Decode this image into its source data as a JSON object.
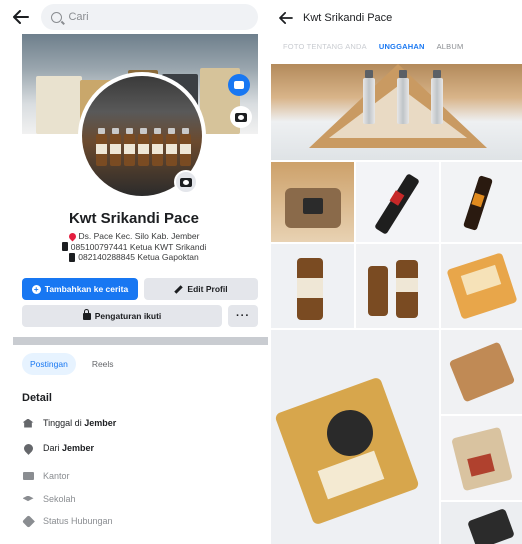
{
  "left": {
    "search": {
      "placeholder": "Cari"
    },
    "profile": {
      "name": "Kwt Srikandi Pace",
      "bio": [
        "Ds. Pace Kec. Silo Kab. Jember",
        "085100797441 Ketua KWT Srikandi",
        "082140288845 Ketua Gapoktan"
      ]
    },
    "buttons": {
      "add_story": "Tambahkan ke cerita",
      "edit_profile": "Edit Profil",
      "follow_settings": "Pengaturan ikuti",
      "more": "···"
    },
    "tabs": [
      "Postingan",
      "Reels"
    ],
    "details": {
      "title": "Detail",
      "lives_prefix": "Tinggal di",
      "lives_value": "Jember",
      "from_prefix": "Dari",
      "from_value": "Jember",
      "work": "Kantor",
      "school": "Sekolah",
      "relationship": "Status Hubungan"
    }
  },
  "right": {
    "title": "Kwt Srikandi Pace",
    "tabs": [
      "FOTO TENTANG ANDA",
      "UNGGAHAN",
      "ALBUM"
    ],
    "active_tab": "UNGGAHAN"
  },
  "colors": {
    "accent": "#1877f2",
    "button_grey": "#e4e6eb",
    "text": "#1c1e21",
    "muted": "#8a8d91"
  },
  "icons": [
    "back-arrow-icon",
    "search-icon",
    "camera-icon",
    "plus-icon",
    "pencil-icon",
    "lock-icon",
    "more-icon",
    "home-icon",
    "location-pin-icon",
    "briefcase-icon",
    "graduation-cap-icon",
    "heart-icon",
    "phone-icon"
  ]
}
